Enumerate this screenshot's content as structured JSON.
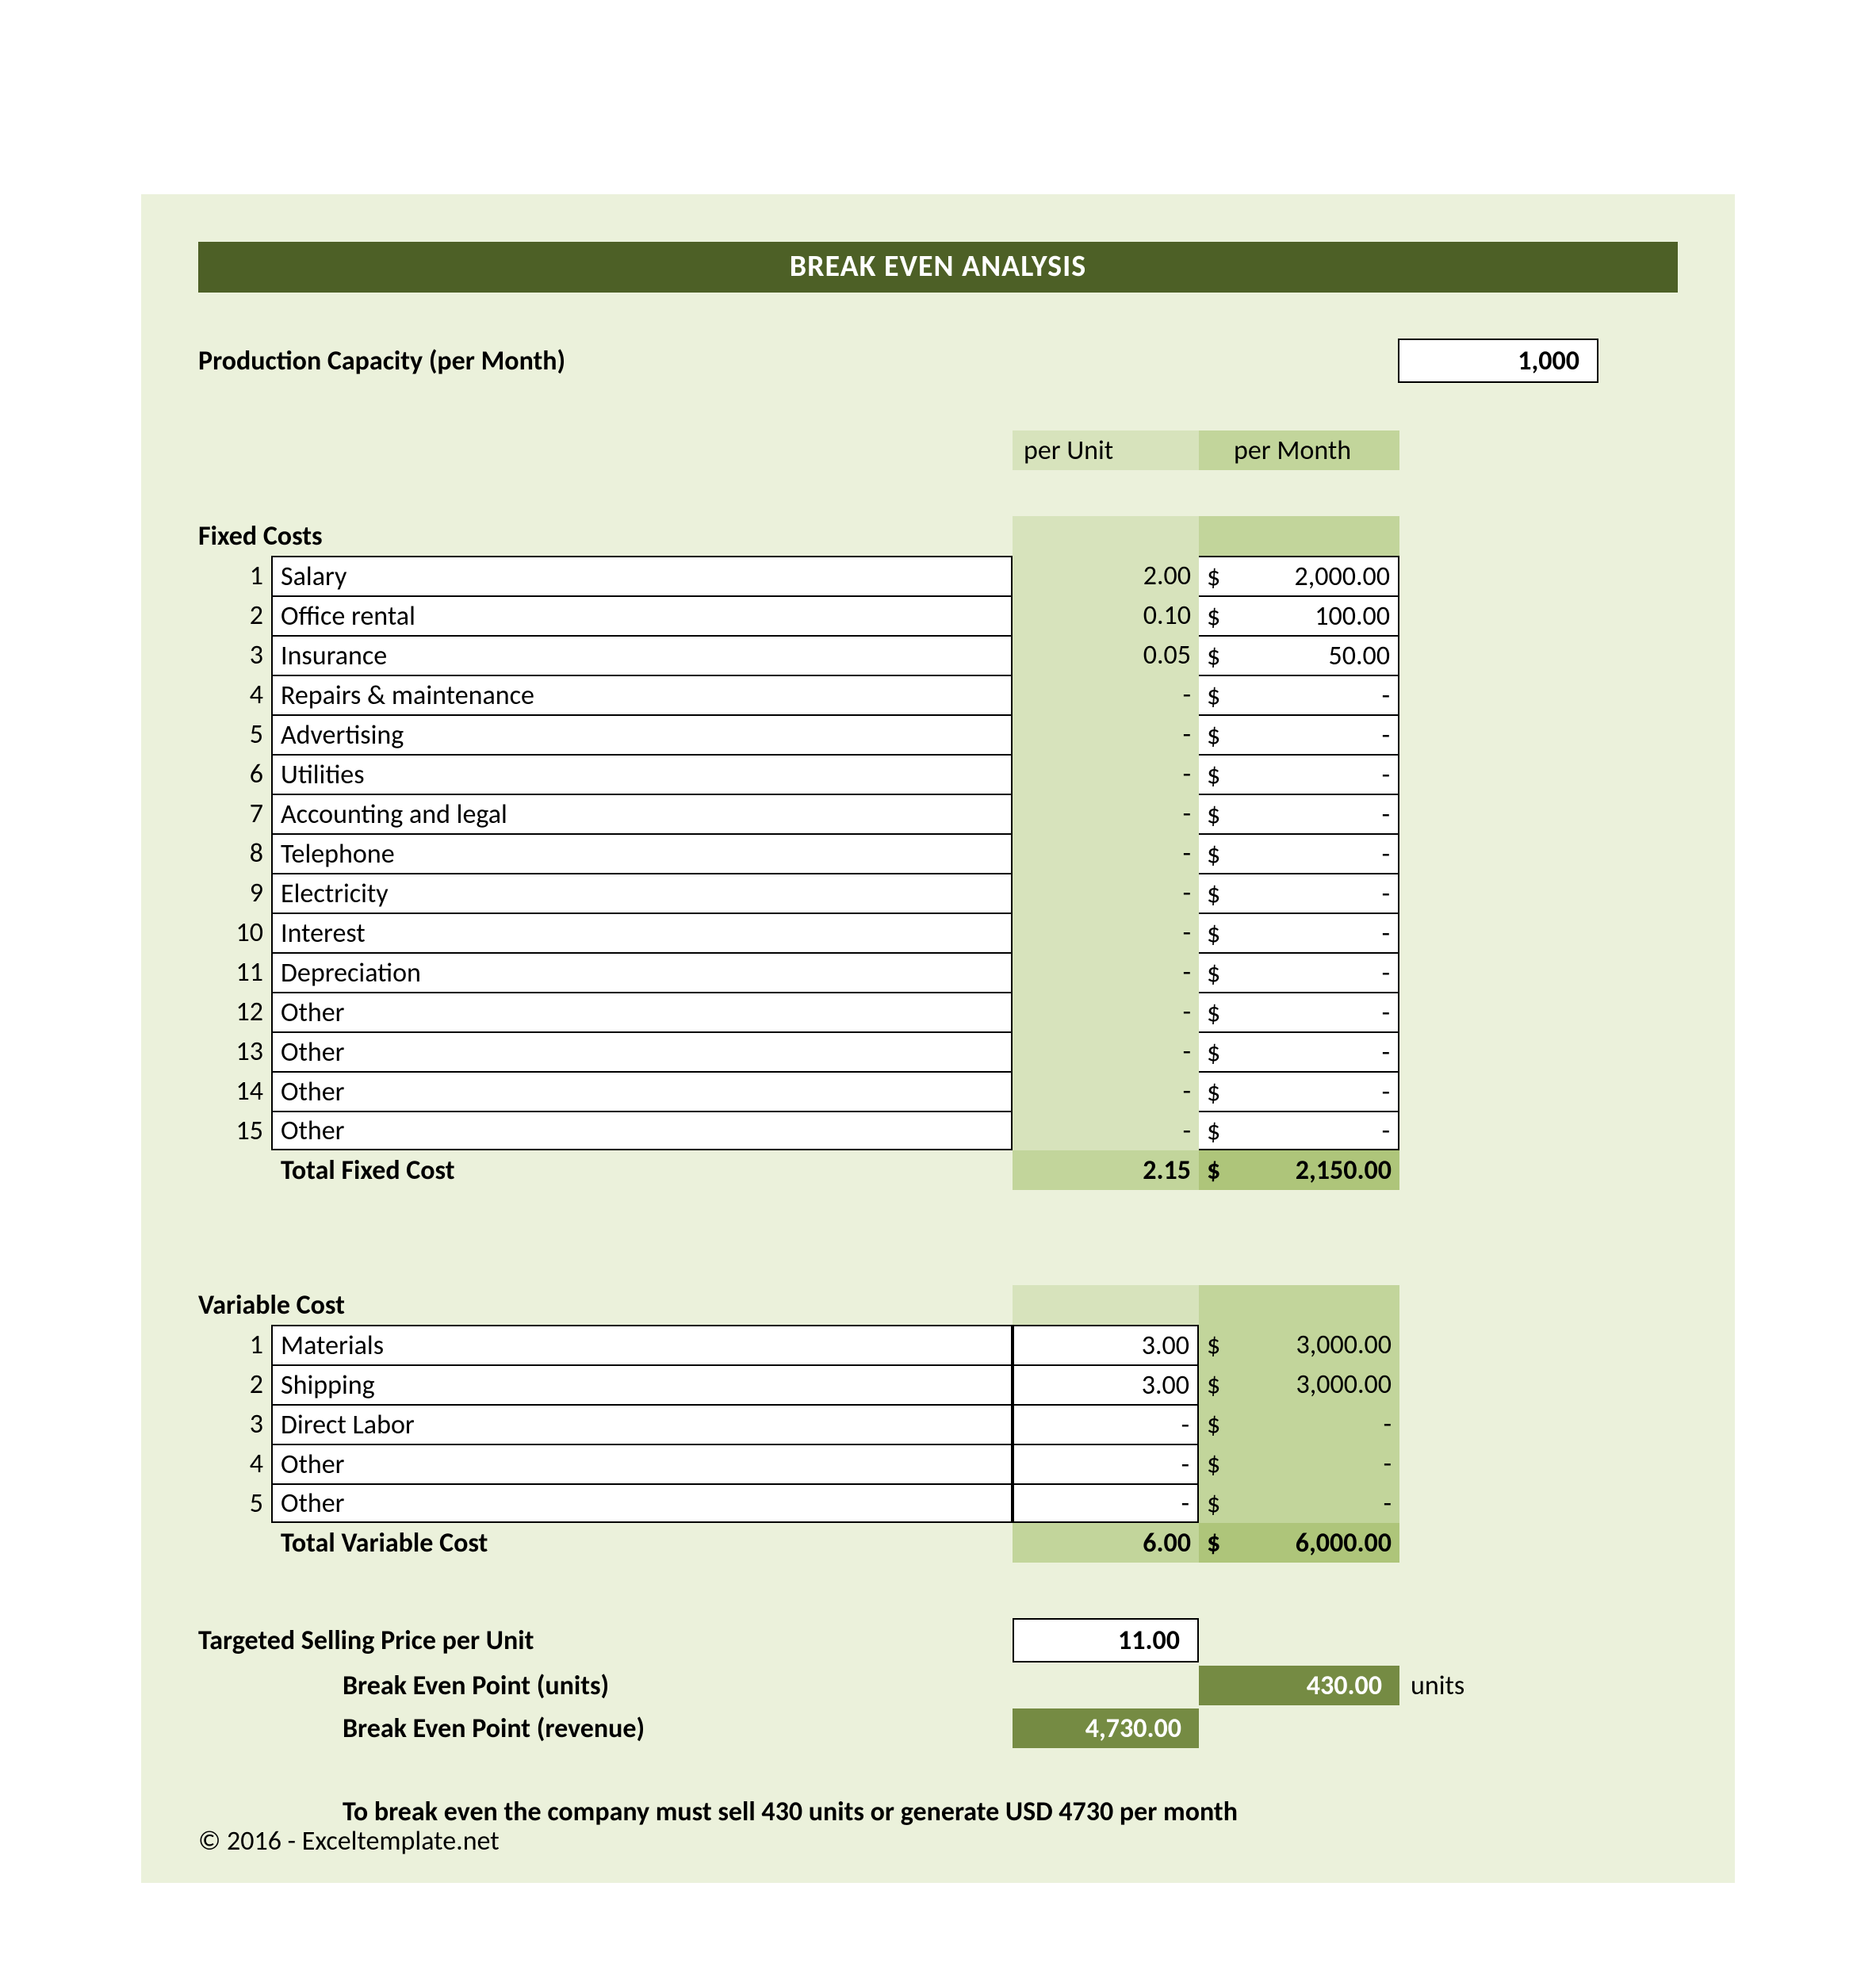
{
  "title": "BREAK EVEN ANALYSIS",
  "production_capacity": {
    "label": "Production Capacity (per Month)",
    "value": "1,000"
  },
  "col_headers": {
    "per_unit": "per Unit",
    "per_month": "per Month"
  },
  "fixed": {
    "label": "Fixed Costs",
    "rows": [
      {
        "idx": "1",
        "desc": "Salary",
        "pu": "2.00",
        "cur": "$",
        "pm": "2,000.00"
      },
      {
        "idx": "2",
        "desc": "Office rental",
        "pu": "0.10",
        "cur": "$",
        "pm": "100.00"
      },
      {
        "idx": "3",
        "desc": "Insurance",
        "pu": "0.05",
        "cur": "$",
        "pm": "50.00"
      },
      {
        "idx": "4",
        "desc": "Repairs & maintenance",
        "pu": "-",
        "cur": "$",
        "pm": "-"
      },
      {
        "idx": "5",
        "desc": "Advertising",
        "pu": "-",
        "cur": "$",
        "pm": "-"
      },
      {
        "idx": "6",
        "desc": "Utilities",
        "pu": "-",
        "cur": "$",
        "pm": "-"
      },
      {
        "idx": "7",
        "desc": "Accounting and legal",
        "pu": "-",
        "cur": "$",
        "pm": "-"
      },
      {
        "idx": "8",
        "desc": "Telephone",
        "pu": "-",
        "cur": "$",
        "pm": "-"
      },
      {
        "idx": "9",
        "desc": "Electricity",
        "pu": "-",
        "cur": "$",
        "pm": "-"
      },
      {
        "idx": "10",
        "desc": "Interest",
        "pu": "-",
        "cur": "$",
        "pm": "-"
      },
      {
        "idx": "11",
        "desc": "Depreciation",
        "pu": "-",
        "cur": "$",
        "pm": "-"
      },
      {
        "idx": "12",
        "desc": "Other",
        "pu": "-",
        "cur": "$",
        "pm": "-"
      },
      {
        "idx": "13",
        "desc": "Other",
        "pu": "-",
        "cur": "$",
        "pm": "-"
      },
      {
        "idx": "14",
        "desc": "Other",
        "pu": "-",
        "cur": "$",
        "pm": "-"
      },
      {
        "idx": "15",
        "desc": "Other",
        "pu": "-",
        "cur": "$",
        "pm": "-"
      }
    ],
    "total": {
      "label": "Total Fixed Cost",
      "pu": "2.15",
      "cur": "$",
      "pm": "2,150.00"
    }
  },
  "variable": {
    "label": "Variable Cost",
    "rows": [
      {
        "idx": "1",
        "desc": "Materials",
        "pu": "3.00",
        "cur": "$",
        "pm": "3,000.00"
      },
      {
        "idx": "2",
        "desc": "Shipping",
        "pu": "3.00",
        "cur": "$",
        "pm": "3,000.00"
      },
      {
        "idx": "3",
        "desc": "Direct Labor",
        "pu": "-",
        "cur": "$",
        "pm": "-"
      },
      {
        "idx": "4",
        "desc": "Other",
        "pu": "-",
        "cur": "$",
        "pm": "-"
      },
      {
        "idx": "5",
        "desc": "Other",
        "pu": "-",
        "cur": "$",
        "pm": "-"
      }
    ],
    "total": {
      "label": "Total Variable Cost",
      "pu": "6.00",
      "cur": "$",
      "pm": "6,000.00"
    }
  },
  "selling_price": {
    "label": "Targeted Selling Price per Unit",
    "value": "11.00"
  },
  "bep_units": {
    "label": "Break Even Point (units)",
    "value": "430.00",
    "suffix": "units"
  },
  "bep_revenue": {
    "label": "Break Even Point (revenue)",
    "value": "4,730.00"
  },
  "note": "To break even the company must sell 430 units or generate USD 4730 per month",
  "copyright": "© 2016 - Exceltemplate.net"
}
